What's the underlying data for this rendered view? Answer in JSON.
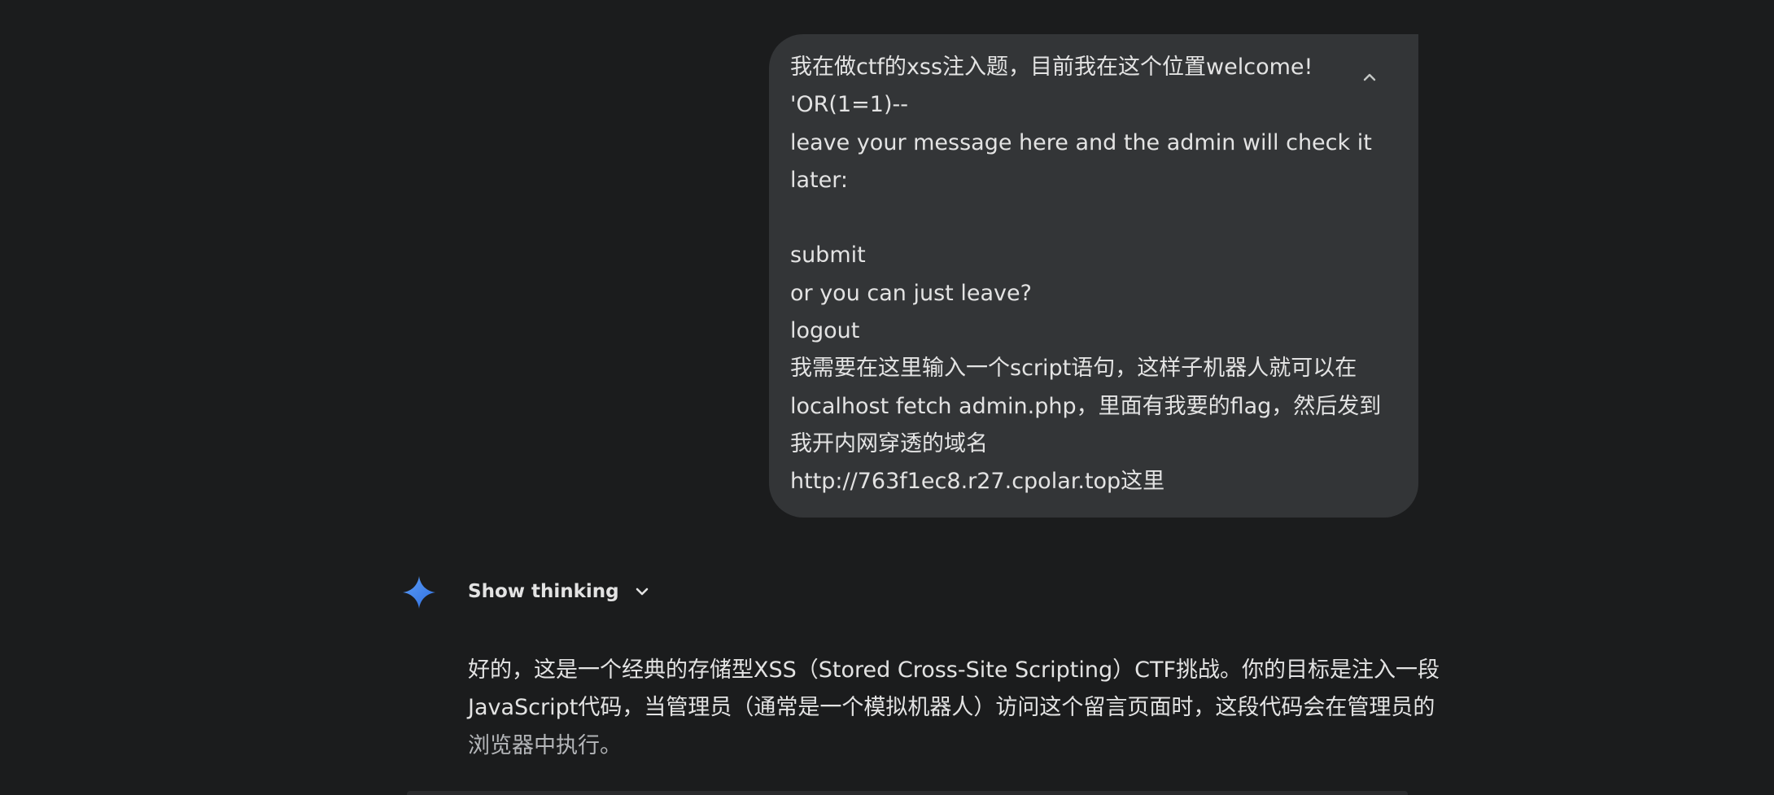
{
  "user_message": {
    "lines": [
      "我在做ctf的xss注入题，目前我在这个位置welcome!",
      "'OR(1=1)--",
      "leave your message here and the admin will check it",
      "later:",
      "",
      "submit",
      "or you can just leave?",
      "logout",
      "我需要在这里输入一个script语句，这样子机器人就可以在",
      "localhost fetch admin.php，里面有我要的flag，然后发到",
      "我开内网穿透的域名",
      "http://763f1ec8.r27.cpolar.top这里"
    ],
    "collapse_icon": "chevron-up-icon"
  },
  "assistant": {
    "avatar_icon": "gemini-sparkle-icon",
    "show_thinking_label": "Show thinking",
    "show_thinking_icon": "chevron-down-icon",
    "response_lines": [
      "好的，这是一个经典的存储型XSS（Stored Cross-Site Scripting）CTF挑战。你的目标是注入一段",
      "JavaScript代码，当管理员（通常是一个模拟机器人）访问这个留言页面时，这段代码会在管理员的",
      "浏览器中执行。"
    ]
  },
  "colors": {
    "background": "#1b1c1d",
    "bubble": "#333537",
    "text": "#e3e3e3",
    "sparkle_blue": "#4285f4"
  }
}
